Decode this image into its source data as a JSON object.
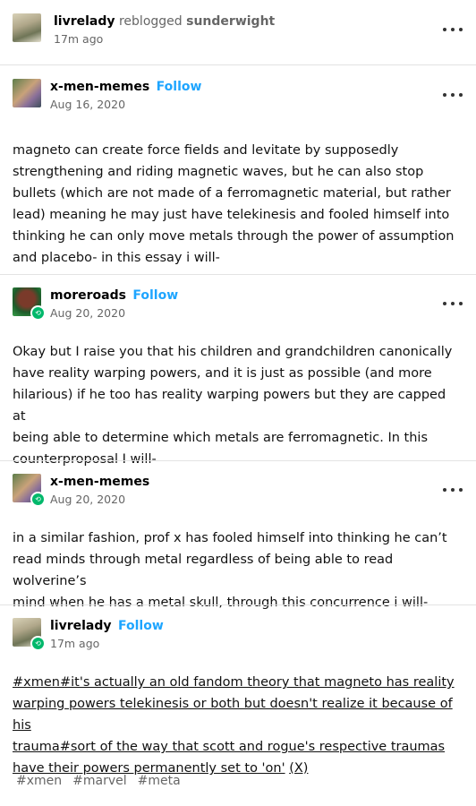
{
  "reblog_header": {
    "username": "livrelady",
    "action": "reblogged",
    "source": "sunderwight",
    "time": "17m ago"
  },
  "posts": [
    {
      "username": "x-men-memes",
      "follow": "Follow",
      "date": "Aug 16, 2020",
      "lines": [
        "magneto can create force fields and levitate by supposedly",
        "strengthening and  riding magnetic waves, but he can also stop",
        "bullets (which are not made of a ferromagnetic material, but rather",
        "lead) meaning he may just have telekinesis and fooled himself into",
        "thinking he can only move metals through the power of assumption",
        "and placebo- in this essay i will-"
      ]
    },
    {
      "username": "moreroads",
      "follow": "Follow",
      "date": "Aug 20, 2020",
      "lines": [
        "Okay but I raise you that his children and grandchildren canonically",
        "have reality warping powers, and it is just as possible (and more",
        "hilarious) if he too has reality warping powers but they are capped at",
        "being able to determine which metals are ferromagnetic. In this",
        "counterproposal I will-"
      ]
    },
    {
      "username": "x-men-memes",
      "date": "Aug 20, 2020",
      "lines": [
        "in a similar fashion, prof x has fooled himself into thinking he can’t",
        "read minds through metal regardless of being able to read wolverine’s",
        "mind when he has a metal skull, through this concurrence i will-"
      ]
    },
    {
      "username": "livrelady",
      "follow": "Follow",
      "date": "17m ago",
      "tag_lines": [
        "#xmen#it's actually an old fandom theory that magneto has reality",
        "warping powers telekinesis or both but doesn't realize it because of his",
        "trauma#sort of the way that scott and rogue's respective traumas",
        "have their powers permanently set to 'on'"
      ],
      "source_link": "(X)"
    }
  ],
  "tags": [
    "#xmen",
    "#marvel",
    "#meta"
  ]
}
